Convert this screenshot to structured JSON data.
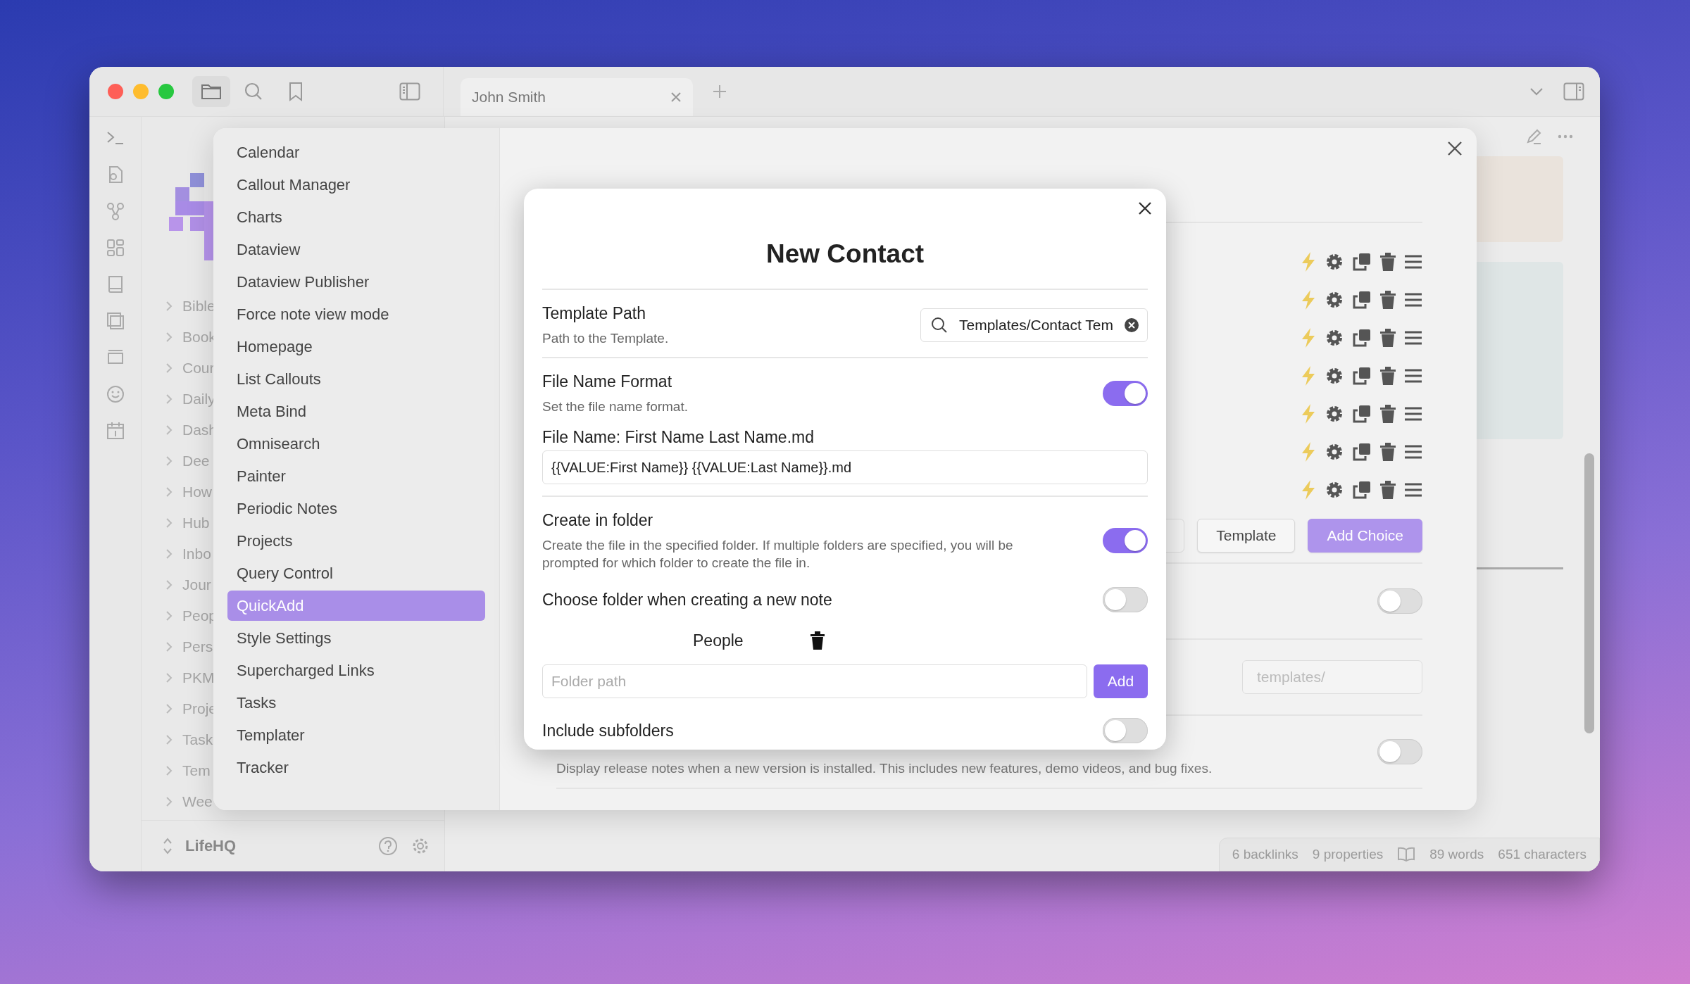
{
  "window": {
    "tab": {
      "title": "John Smith"
    }
  },
  "file_tree": {
    "items": [
      "Bible",
      "Book",
      "Cour",
      "Daily",
      "Dash",
      "Dee",
      "How",
      "Hub",
      "Inbo",
      "Jour",
      "Peop",
      "Pers",
      "PKM",
      "Proje",
      "Task",
      "Tem",
      "Wee"
    ],
    "vault": "LifeHQ"
  },
  "settings": {
    "nav": [
      {
        "label": "Calendar",
        "selected": false
      },
      {
        "label": "Callout Manager",
        "selected": false
      },
      {
        "label": "Charts",
        "selected": false
      },
      {
        "label": "Dataview",
        "selected": false
      },
      {
        "label": "Dataview Publisher",
        "selected": false
      },
      {
        "label": "Force note view mode",
        "selected": false
      },
      {
        "label": "Homepage",
        "selected": false
      },
      {
        "label": "List Callouts",
        "selected": false
      },
      {
        "label": "Meta Bind",
        "selected": false
      },
      {
        "label": "Omnisearch",
        "selected": false
      },
      {
        "label": "Painter",
        "selected": false
      },
      {
        "label": "Periodic Notes",
        "selected": false
      },
      {
        "label": "Projects",
        "selected": false
      },
      {
        "label": "Query Control",
        "selected": false
      },
      {
        "label": "QuickAdd",
        "selected": true
      },
      {
        "label": "Style Settings",
        "selected": false
      },
      {
        "label": "Supercharged Links",
        "selected": false
      },
      {
        "label": "Tasks",
        "selected": false
      },
      {
        "label": "Templater",
        "selected": false
      },
      {
        "label": "Tracker",
        "selected": false
      }
    ],
    "buttons": [
      {
        "label": "Template",
        "kind": "plain"
      },
      {
        "label": "Add Choice",
        "kind": "primary"
      }
    ],
    "hidden_toggle": {
      "on": false
    },
    "template_folder": {
      "placeholder": "templates/"
    },
    "announce": {
      "description": "Display release notes when a new version is installed. This includes new features, demo videos, and bug fixes.",
      "on": false
    }
  },
  "modal": {
    "title": "New Contact",
    "settings": [
      {
        "kind": "search",
        "name": "Template Path",
        "description": "Path to the Template.",
        "value": "Templates/Contact Tem"
      },
      {
        "kind": "toggle",
        "name": "File Name Format",
        "description": "Set the file name format.",
        "on": true
      },
      {
        "kind": "text",
        "name": "File Name: First Name Last Name.md",
        "value": "{{VALUE:First Name}} {{VALUE:Last Name}}.md"
      },
      {
        "kind": "toggle",
        "name": "Create in folder",
        "description": "Create the file in the specified folder. If multiple folders are specified, you will be prompted for which folder to create the file in.",
        "on": true
      },
      {
        "kind": "toggle",
        "name": "Choose folder when creating a new note",
        "on": false
      },
      {
        "kind": "folder",
        "name": "People"
      },
      {
        "kind": "add",
        "placeholder": "Folder path",
        "button": "Add"
      },
      {
        "kind": "toggle",
        "name": "Include subfolders",
        "on": false
      }
    ]
  },
  "status_bar": [
    {
      "kind": "text",
      "label": "6 backlinks"
    },
    {
      "kind": "text",
      "label": "9 properties"
    },
    {
      "kind": "reading"
    },
    {
      "kind": "text",
      "label": "89 words"
    },
    {
      "kind": "text",
      "label": "651 characters"
    }
  ]
}
